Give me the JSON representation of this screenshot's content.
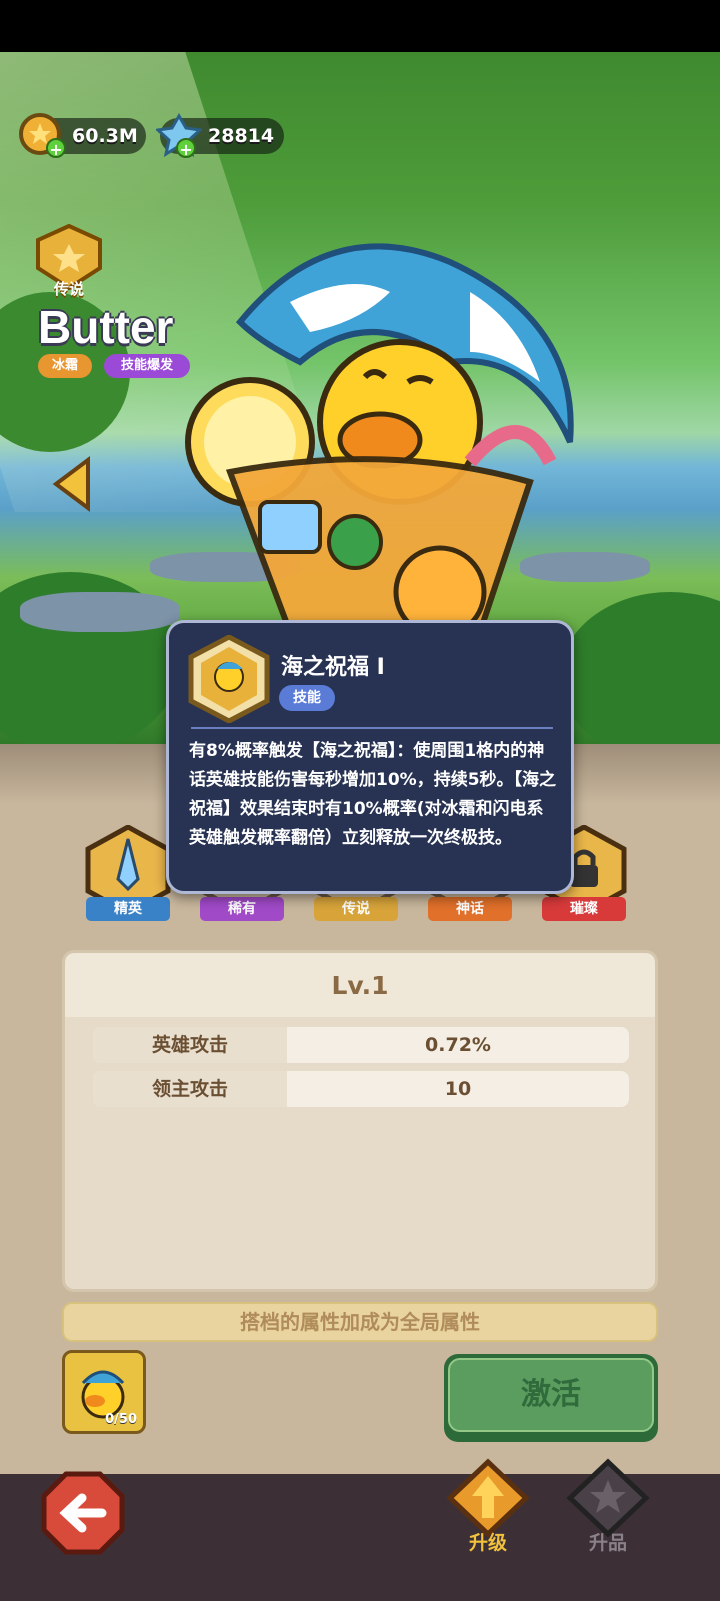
{
  "currency": {
    "gold": "60.3M",
    "gems": "28814"
  },
  "hero": {
    "rank": "传说",
    "name": "Butter",
    "tags": [
      "冰霜",
      "技能爆发"
    ]
  },
  "rarity_tabs": [
    "精英",
    "稀有",
    "传说",
    "神话",
    "璀璨"
  ],
  "tooltip": {
    "title": "海之祝福 I",
    "type": "技能",
    "description": "有8%概率触发【海之祝福】：使周围1格内的神话英雄技能伤害每秒增加10%，持续5秒。【海之祝福】效果结束时有10%概率(对冰霜和闪电系英雄触发概率翻倍）立刻释放一次终极技。"
  },
  "stats": {
    "level": "Lv.1",
    "rows": [
      {
        "name": "英雄攻击",
        "value": "0.72%"
      },
      {
        "name": "领主攻击",
        "value": "10"
      }
    ]
  },
  "note": "搭档的属性加成为全局属性",
  "partner": {
    "count": "0/50"
  },
  "activate_label": "激活",
  "bottom_tabs": {
    "upgrade": "升级",
    "promote": "升品"
  },
  "colors": {
    "accent_gold": "#f0b035",
    "tooltip_bg": "#283353",
    "activate_green": "#5b9c5f"
  },
  "icons": [
    "gold-coin-icon",
    "gem-icon",
    "plus-icon",
    "rank-badge-icon",
    "left-arrow-icon",
    "back-arrow-icon",
    "upgrade-arrow-icon",
    "promote-star-icon",
    "lock-icon",
    "sword-icon"
  ]
}
